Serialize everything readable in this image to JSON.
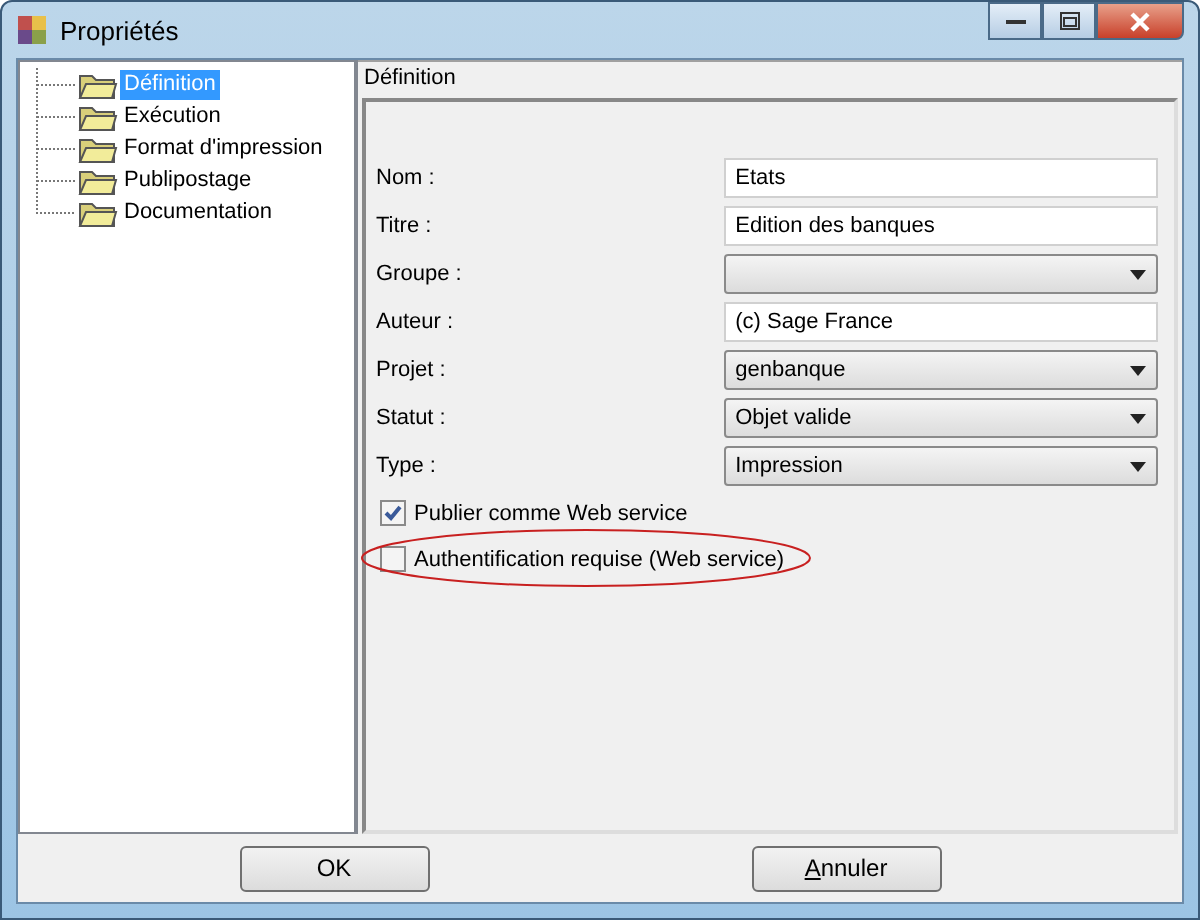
{
  "window": {
    "title": "Propriétés"
  },
  "tree": {
    "items": [
      {
        "label": "Définition",
        "selected": true
      },
      {
        "label": "Exécution",
        "selected": false
      },
      {
        "label": "Format d'impression",
        "selected": false
      },
      {
        "label": "Publipostage",
        "selected": false
      },
      {
        "label": "Documentation",
        "selected": false
      }
    ]
  },
  "panel": {
    "header": "Définition",
    "fields": [
      {
        "label": "Nom :",
        "kind": "text",
        "value": "Etats"
      },
      {
        "label": "Titre :",
        "kind": "text",
        "value": "Edition des banques"
      },
      {
        "label": "Groupe :",
        "kind": "dropdown"
      },
      {
        "label": "Auteur :",
        "kind": "text",
        "value": "(c) Sage France"
      },
      {
        "label": "Projet :",
        "kind": "dropdown",
        "value": "genbanque"
      },
      {
        "label": "Statut :",
        "kind": "dropdown",
        "value": "Objet valide"
      },
      {
        "label": "Type :",
        "kind": "dropdown",
        "value": "Impression"
      }
    ],
    "checkboxes": [
      {
        "label": "Publier comme Web service",
        "checked": true,
        "circled": false
      },
      {
        "label": "Authentification requise (Web service)",
        "checked": false,
        "circled": true
      }
    ]
  },
  "buttons": [
    {
      "label": "OK",
      "underline_first": false
    },
    {
      "label": "Annuler",
      "underline_first": true
    }
  ]
}
